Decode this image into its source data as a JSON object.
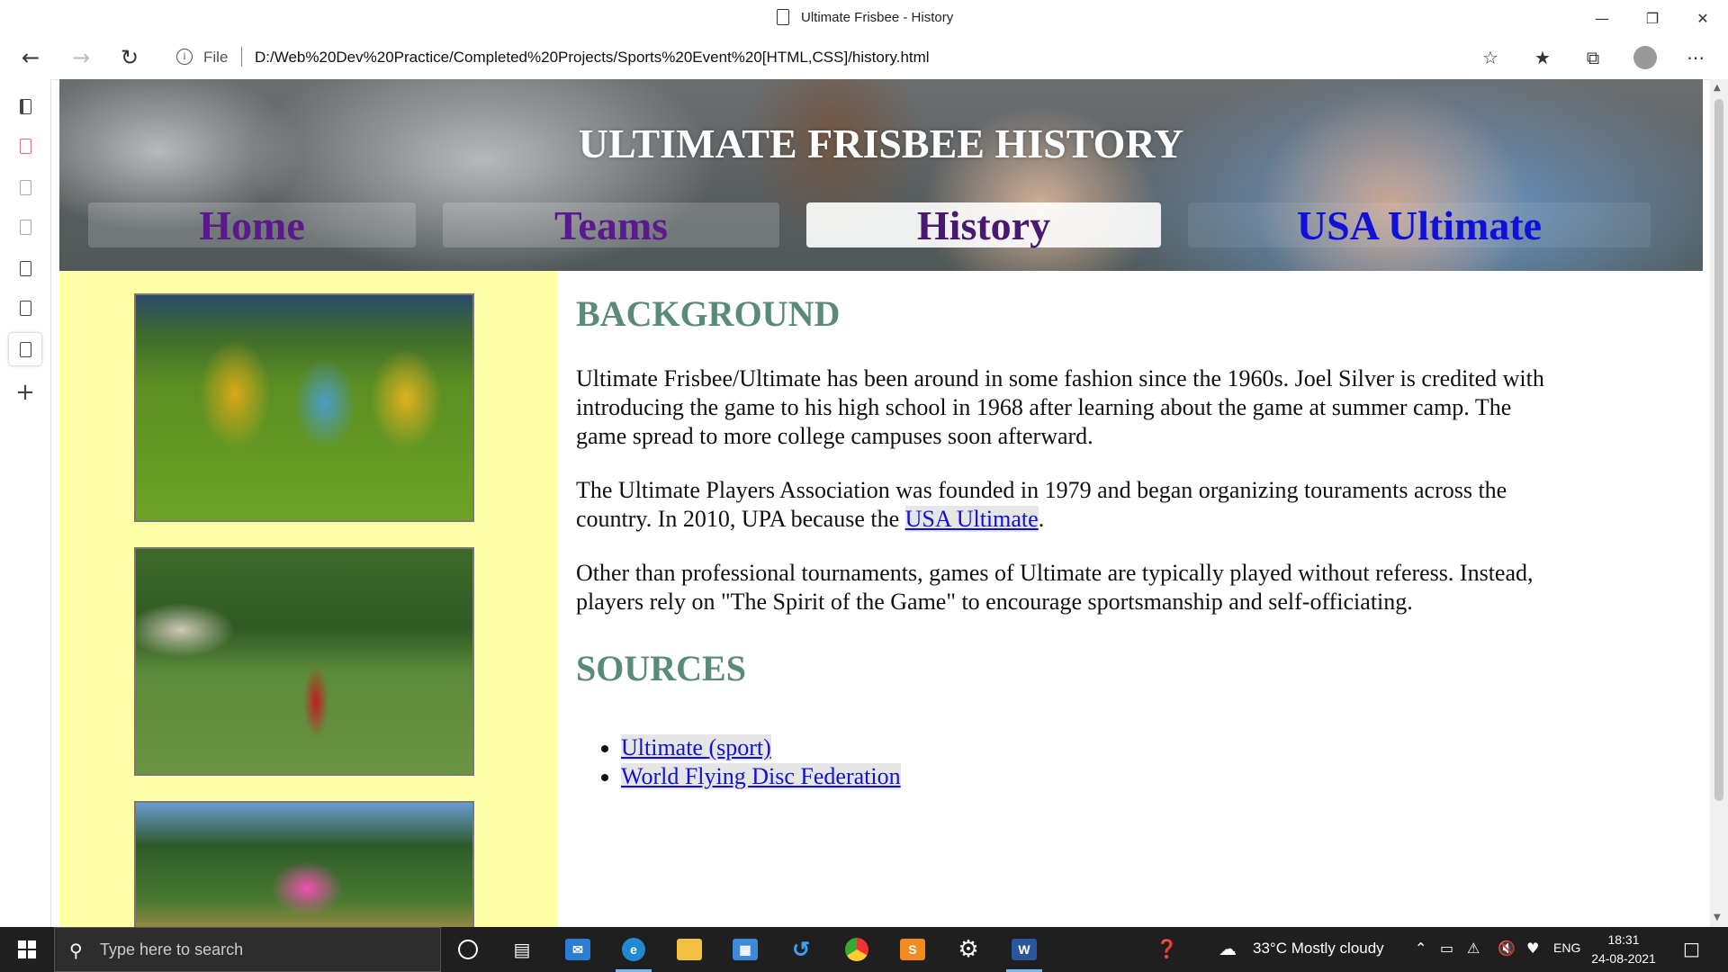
{
  "browser": {
    "tab_title": "Ultimate Frisbee - History",
    "address_label": "File",
    "url": "D:/Web%20Dev%20Practice/Completed%20Projects/Sports%20Event%20[HTML,CSS]/history.html"
  },
  "page": {
    "title": "ULTIMATE FRISBEE HISTORY",
    "nav": [
      {
        "label": "Home",
        "state": "visited"
      },
      {
        "label": "Teams",
        "state": "visited"
      },
      {
        "label": "History",
        "state": "active"
      },
      {
        "label": "USA Ultimate",
        "state": "link"
      }
    ],
    "background_heading": "BACKGROUND",
    "paragraphs": {
      "p1": "Ultimate Frisbee/Ultimate has been around in some fashion since the 1960s. Joel Silver is credited with introducing the game to his high school in 1968 after learning about the game at summer camp. The game spread to more college campuses soon afterward.",
      "p2_before": "The Ultimate Players Association was founded in 1979 and began organizing touraments across the country. In 2010, UPA because the ",
      "p2_link": "USA Ultimate",
      "p2_after": ".",
      "p3": "Other than professional tournaments, games of Ultimate are typically played without referess. Instead, players rely on \"The Spirit of the Game\" to encourage sportsmanship and self-officiating."
    },
    "sources_heading": "SOURCES",
    "sources": [
      "Ultimate (sport)",
      "World Flying Disc Federation"
    ]
  },
  "taskbar": {
    "search_placeholder": "Type here to search",
    "weather": "33°C  Mostly cloudy",
    "language": "ENG",
    "time": "18:31",
    "date": "24-08-2021"
  },
  "colors": {
    "heading": "#5a8a7c",
    "sidebar_bg": "#ffffa8",
    "link": "#1010d8",
    "visited": "#5b1a8c"
  }
}
